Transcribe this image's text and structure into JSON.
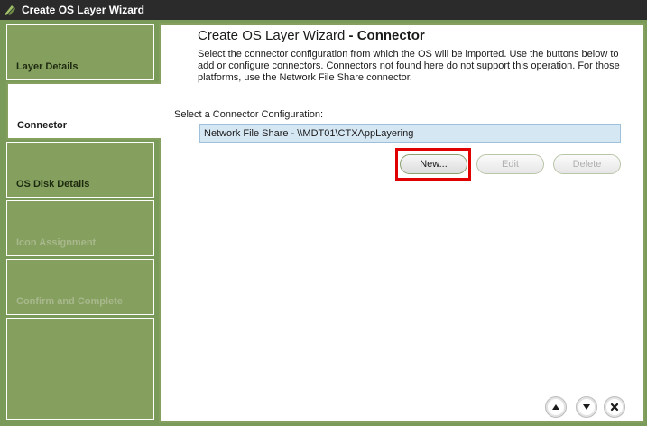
{
  "window": {
    "title": "Create OS Layer Wizard"
  },
  "nav": {
    "items": [
      {
        "label": "Layer Details",
        "state": "normal"
      },
      {
        "label": "Connector",
        "state": "active"
      },
      {
        "label": "OS Disk Details",
        "state": "normal"
      },
      {
        "label": "Icon Assignment",
        "state": "disabled"
      },
      {
        "label": "Confirm and Complete",
        "state": "disabled"
      },
      {
        "label": "",
        "state": "normal"
      }
    ]
  },
  "page": {
    "title_prefix": "Create OS Layer Wizard",
    "title_suffix": " - Connector",
    "description": "Select the connector configuration from which the OS will be imported.  Use the buttons below to add or configure connectors. Connectors not found here do not support this operation. For those platforms, use the Network File Share connector.",
    "select_label": "Select a Connector Configuration:",
    "connector_selected": "Network File Share - \\\\MDT01\\CTXAppLayering"
  },
  "buttons": {
    "new": "New...",
    "edit": "Edit",
    "delete": "Delete"
  },
  "footer": {
    "icons": [
      "arrow-up-icon",
      "arrow-down-icon",
      "close-icon"
    ]
  },
  "colors": {
    "sidebar_green": "#849f5e",
    "highlight_red": "#e00000",
    "titlebar": "#2b2b2b",
    "selected_row": "#d6e7f4"
  }
}
